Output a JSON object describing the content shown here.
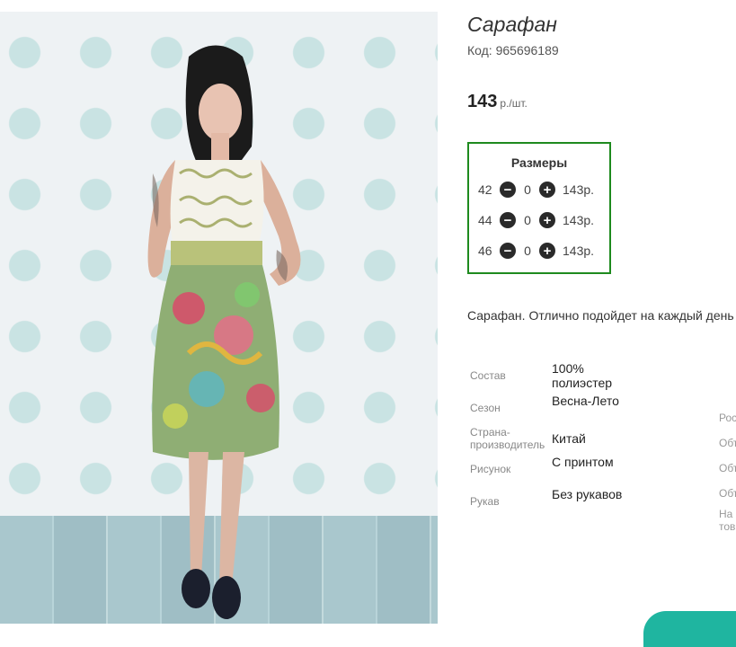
{
  "product": {
    "title": "Сарафан",
    "code_label": "Код:",
    "code_value": "965696189",
    "price_value": "143",
    "price_unit": "р./шт."
  },
  "sizes": {
    "title": "Размеры",
    "rows": [
      {
        "size": "42",
        "minus_icon": "minus-circle-icon",
        "qty": "0",
        "plus_icon": "plus-circle-icon",
        "price": "143р."
      },
      {
        "size": "44",
        "minus_icon": "minus-circle-icon",
        "qty": "0",
        "plus_icon": "plus-circle-icon",
        "price": "143р."
      },
      {
        "size": "46",
        "minus_icon": "minus-circle-icon",
        "qty": "0",
        "plus_icon": "plus-circle-icon",
        "price": "143р."
      }
    ],
    "border_color": "#1e8a1e"
  },
  "description": "Сарафан. Отлично подойдет на каждый день",
  "properties": [
    {
      "key": "Состав",
      "value": "100% полиэстер"
    },
    {
      "key": "Сезон",
      "value": "Весна-Лето"
    },
    {
      "key": "Страна-производитель",
      "value": "Китай"
    },
    {
      "key": "Рисунок",
      "value": "С принтом"
    },
    {
      "key": "Рукав",
      "value": "Без рукавов"
    }
  ],
  "right_column_partial": [
    "Рос",
    "Объ",
    "Объ",
    "Объ",
    "На",
    "тов"
  ],
  "accent_color": "#1fb5a0"
}
